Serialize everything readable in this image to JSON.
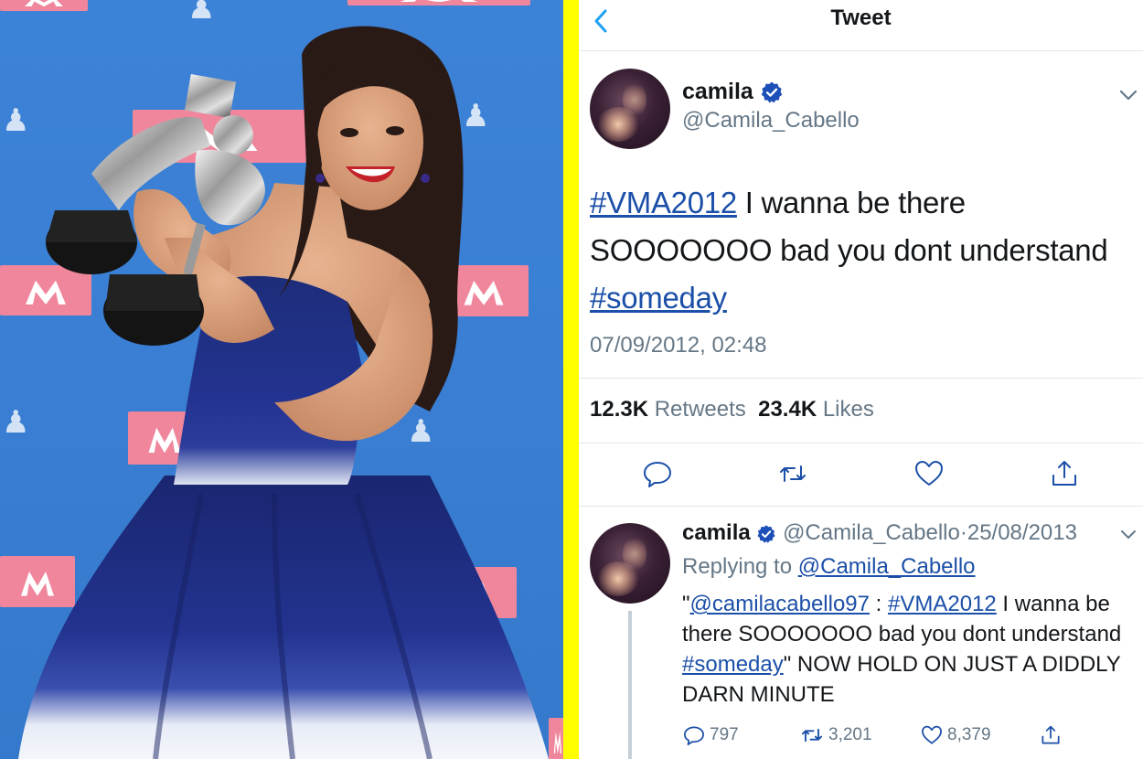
{
  "header": {
    "title": "Tweet"
  },
  "tweet": {
    "display_name": "camila",
    "handle": "@Camila_Cabello",
    "text_hashtag_1": "#VMA2012",
    "text_middle": " I wanna be there SOOOOOOO bad you dont understand ",
    "text_hashtag_2": "#someday",
    "timestamp": "07/09/2012, 02:48",
    "retweets_count": "12.3K",
    "retweets_label": "Retweets",
    "likes_count": "23.4K",
    "likes_label": "Likes"
  },
  "reply": {
    "display_name": "camila",
    "handle": "@Camila_Cabello",
    "date_separator": "·",
    "date": "25/08/2013",
    "replying_prefix": "Replying to ",
    "replying_to": "@Camila_Cabello",
    "quote_open": "\"",
    "mention": "@camilacabello97",
    "colon": " : ",
    "hashtag_1": "#VMA2012",
    "middle": " I wanna be there SOOOOOOO bad you dont understand ",
    "hashtag_2": "#someday",
    "tail": "\" NOW HOLD ON JUST A DIDDLY DARN MINUTE",
    "reply_count": "797",
    "retweet_count": "3,201",
    "like_count": "8,379"
  },
  "colors": {
    "divider": "#ffff00",
    "link": "#1b4fa8",
    "secondary_text": "#657786",
    "verified_badge": "#1d4fb8",
    "backdrop_blue": "#3a7fd3",
    "mtv_pink": "#f0869c"
  },
  "icons": {
    "back": "chevron-left-icon",
    "verified": "verified-badge-icon",
    "more": "chevron-down-icon",
    "reply": "speech-bubble-icon",
    "retweet": "retweet-icon",
    "like": "heart-icon",
    "share": "share-icon"
  }
}
